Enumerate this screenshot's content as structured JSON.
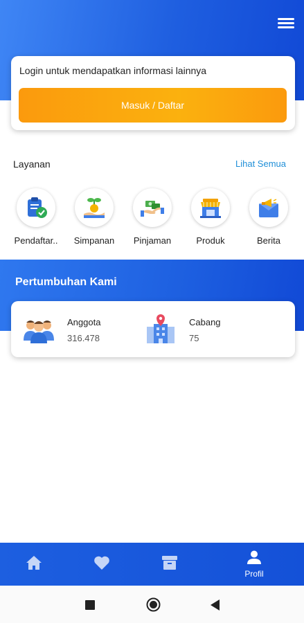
{
  "header": {
    "menu_icon": "hamburger-menu-icon"
  },
  "login_card": {
    "text": "Login untuk mendapatkan informasi lainnya",
    "button_label": "Masuk / Daftar"
  },
  "services": {
    "title": "Layanan",
    "see_all": "Lihat Semua",
    "items": [
      {
        "label": "Pendaftar..",
        "icon": "clipboard-check-icon"
      },
      {
        "label": "Simpanan",
        "icon": "coin-plant-icon"
      },
      {
        "label": "Pinjaman",
        "icon": "money-handshake-icon"
      },
      {
        "label": "Produk",
        "icon": "store-icon"
      },
      {
        "label": "Berita",
        "icon": "megaphone-mail-icon"
      }
    ]
  },
  "growth": {
    "title": "Pertumbuhan Kami",
    "stats": [
      {
        "label": "Anggota",
        "value": "316.478",
        "icon": "people-group-icon"
      },
      {
        "label": "Cabang",
        "value": "75",
        "icon": "building-pin-icon"
      }
    ]
  },
  "bottom_nav": {
    "items": [
      {
        "label": "",
        "icon": "home-icon"
      },
      {
        "label": "",
        "icon": "heart-icon"
      },
      {
        "label": "",
        "icon": "archive-box-icon"
      },
      {
        "label": "Profil",
        "icon": "user-icon"
      }
    ]
  },
  "colors": {
    "primary": "#1d5fe0",
    "accent_orange": "#fba50e",
    "link": "#1f8fd8"
  }
}
